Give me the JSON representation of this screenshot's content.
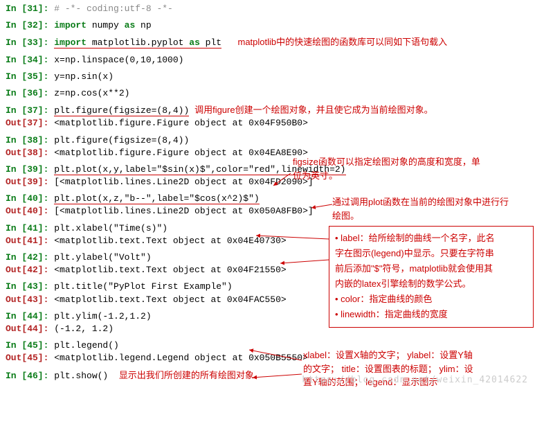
{
  "cells": {
    "c31": {
      "in_label": "In [31]: ",
      "code": "# -*- coding:utf-8 -*-"
    },
    "c32": {
      "in_label": "In [32]: ",
      "code_pre": "import",
      "code_rest": " numpy ",
      "code_as": "as",
      "code_np": " np"
    },
    "c33": {
      "in_label": "In [33]: ",
      "code_pre": "import",
      "code_rest": " matplotlib.pyplot ",
      "code_as": "as",
      "code_plt": " plt",
      "note": "matplotlib中的快速绘图的函数库可以同如下语句载入"
    },
    "c34": {
      "in_label": "In [34]: ",
      "code": "x=np.linspace(0,10,1000)"
    },
    "c35": {
      "in_label": "In [35]: ",
      "code": "y=np.sin(x)"
    },
    "c36": {
      "in_label": "In [36]: ",
      "code": "z=np.cos(x**2)"
    },
    "c37": {
      "in_label": "In [37]: ",
      "code": "plt.figure(figsize=(8,4))",
      "out_label": "Out[37]: ",
      "out": "<matplotlib.figure.Figure object at 0x04F950B0>",
      "note_top": "调用figure创建一个绘图对象，并且使它成为当前绘图对象。"
    },
    "c38": {
      "in_label": "In [38]: ",
      "code": "plt.figure(figsize=(8,4))",
      "out_label": "Out[38]: ",
      "out": "<matplotlib.figure.Figure object at 0x04EA8E90>",
      "note_side": "figsize函数可以指定绘图对象的高度和宽度，单位为英寸。"
    },
    "c39": {
      "in_label": "In [39]: ",
      "code": "plt.plot(x,y,label=\"$sin(x)$\",color=\"red\",linewidth=2)",
      "out_label": "Out[39]: ",
      "out": "[<matplotlib.lines.Line2D object at 0x04FD2090>]",
      "note_side": "通过调用plot函数在当前的绘图对象中进行行绘图。"
    },
    "c40": {
      "in_label": "In [40]: ",
      "code": "plt.plot(x,z,\"b--\",label=\"$cos(x^2)$\")",
      "out_label": "Out[40]: ",
      "out": "[<matplotlib.lines.Line2D object at 0x050A8FB0>]"
    },
    "c41": {
      "in_label": "In [41]: ",
      "code": "plt.xlabel(\"Time(s)\")",
      "out_label": "Out[41]: ",
      "out": "<matplotlib.text.Text object at 0x04E40730>"
    },
    "c42": {
      "in_label": "In [42]: ",
      "code": "plt.ylabel(\"Volt\")",
      "out_label": "Out[42]: ",
      "out": "<matplotlib.text.Text object at 0x04F21550>"
    },
    "c43": {
      "in_label": "In [43]: ",
      "code": "plt.title(\"PyPlot First Example\")",
      "out_label": "Out[43]: ",
      "out": "<matplotlib.text.Text object at 0x04FAC550>"
    },
    "c44": {
      "in_label": "In [44]: ",
      "code": "plt.ylim(-1.2,1.2)",
      "out_label": "Out[44]: ",
      "out": "(-1.2, 1.2)"
    },
    "c45": {
      "in_label": "In [45]: ",
      "code": "plt.legend()",
      "out_label": "Out[45]: ",
      "out": "<matplotlib.legend.Legend object at 0x050B5550>"
    },
    "c46": {
      "in_label": "In [46]: ",
      "code": "plt.show()",
      "note": "显示出我们所创建的所有绘图对象"
    }
  },
  "legend_box": {
    "l1": "• label：给所绘制的曲线一个名字，此名",
    "l2": "字在图示(legend)中显示。只要在字符串",
    "l3": "前后添加\"$\"符号，matplotlib就会使用其",
    "l4": "内嵌的latex引擎绘制的数学公式。",
    "l5": "• color：指定曲线的颜色",
    "l6": "• linewidth：指定曲线的宽度"
  },
  "bottom_note": {
    "l1": "xlabel：设置X轴的文字； ylabel：设置Y轴",
    "l2": "的文字； title：设置图表的标题； ylim：设",
    "l3": "置Y轴的范围； legend：显示图示"
  },
  "watermark": "https://blog.csdn.net/weixin_42014622"
}
